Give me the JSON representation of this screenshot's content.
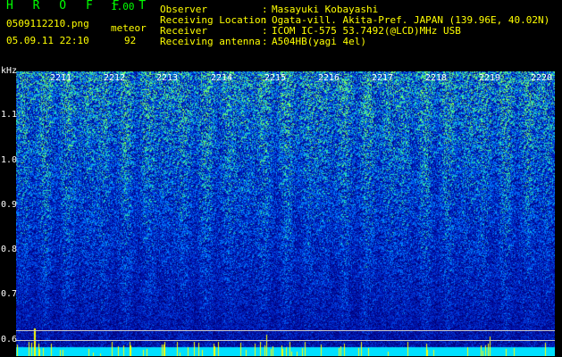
{
  "header": {
    "app_title": "H R O F F T",
    "version": "1.00",
    "filename": "0509112210.png",
    "datetime": "05.09.11 22:10",
    "mode": "meteor",
    "count": "92"
  },
  "info": [
    {
      "label": "Observer",
      "value": "Masayuki Kobayashi"
    },
    {
      "label": "Receiving Location",
      "value": "Ogata-vill. Akita-Pref. JAPAN (139.96E, 40.02N)"
    },
    {
      "label": "Receiver",
      "value": "ICOM IC-575 53.7492(@LCD)MHz USB"
    },
    {
      "label": "Receiving antenna",
      "value": "A504HB(yagi 4el)"
    }
  ],
  "colon": ":",
  "spectrogram": {
    "y_unit": "kHz",
    "y_ticks": [
      "1.1",
      "1.0",
      "0.9",
      "0.8",
      "0.7",
      "0.6"
    ],
    "x_ticks": [
      "2211",
      "2212",
      "2213",
      "2214",
      "2215",
      "2216",
      "2217",
      "2218",
      "2219",
      "2220"
    ],
    "colors": {
      "background": "#00007a",
      "low": "#0030c0",
      "mid": "#00a0ff",
      "high": "#40ff80",
      "peak": "#ffff00"
    }
  }
}
